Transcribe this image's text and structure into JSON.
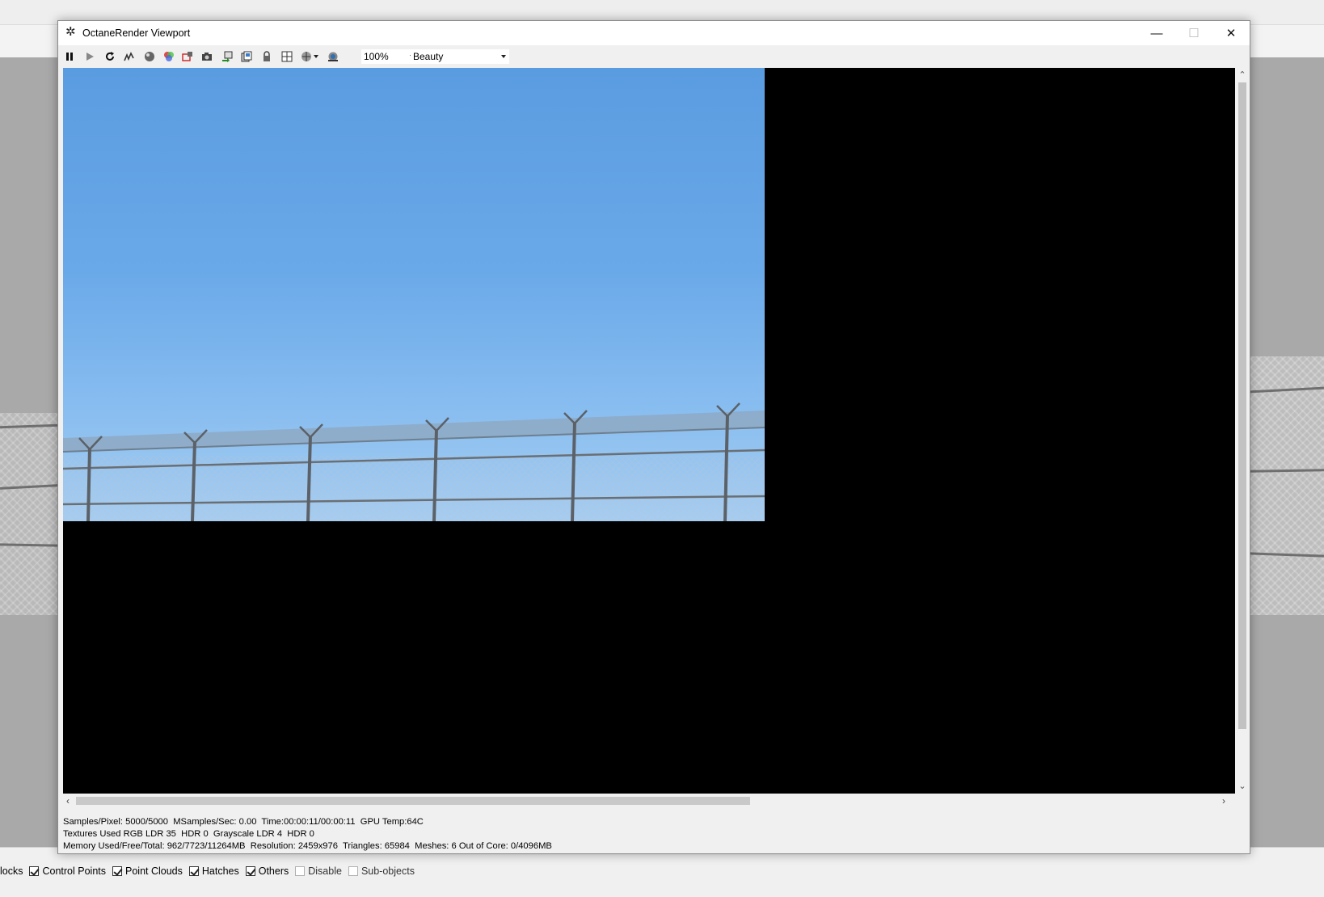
{
  "window": {
    "title": "OctaneRender Viewport",
    "minimize_glyph": "—",
    "maximize_glyph": "☐",
    "close_glyph": "✕"
  },
  "toolbar": {
    "zoom_value": "100%",
    "pass_value": "Beauty",
    "icons": [
      "pause-icon",
      "play-icon",
      "restart-icon",
      "denoise-icon",
      "sphere-icon",
      "color-picker-icon",
      "region-render-icon",
      "camera-icon",
      "export-icon",
      "save-icon",
      "lock-icon",
      "layout-icon",
      "world-icon",
      "render-settings-icon"
    ]
  },
  "status": {
    "line1": "Samples/Pixel: 5000/5000  MSamples/Sec: 0.00  Time:00:00:11/00:00:11  GPU Temp:64C",
    "line2": "Textures Used RGB LDR 35  HDR 0  Grayscale LDR 4  HDR 0",
    "line3": "Memory Used/Free/Total: 962/7723/11264MB  Resolution: 2459x976  Triangles: 65984  Meshes: 6 Out of Core: 0/4096MB"
  },
  "host": {
    "filters": [
      {
        "label": "locks",
        "checked": null
      },
      {
        "label": "Control Points",
        "checked": true
      },
      {
        "label": "Point Clouds",
        "checked": true
      },
      {
        "label": "Hatches",
        "checked": true
      },
      {
        "label": "Others",
        "checked": true
      },
      {
        "label": "Disable",
        "checked": false
      },
      {
        "label": "Sub-objects",
        "checked": false
      }
    ]
  },
  "colors": {
    "sky_top": "#5a9ce0",
    "sky_bottom": "#a6cdf1",
    "render_background": "#000000"
  }
}
